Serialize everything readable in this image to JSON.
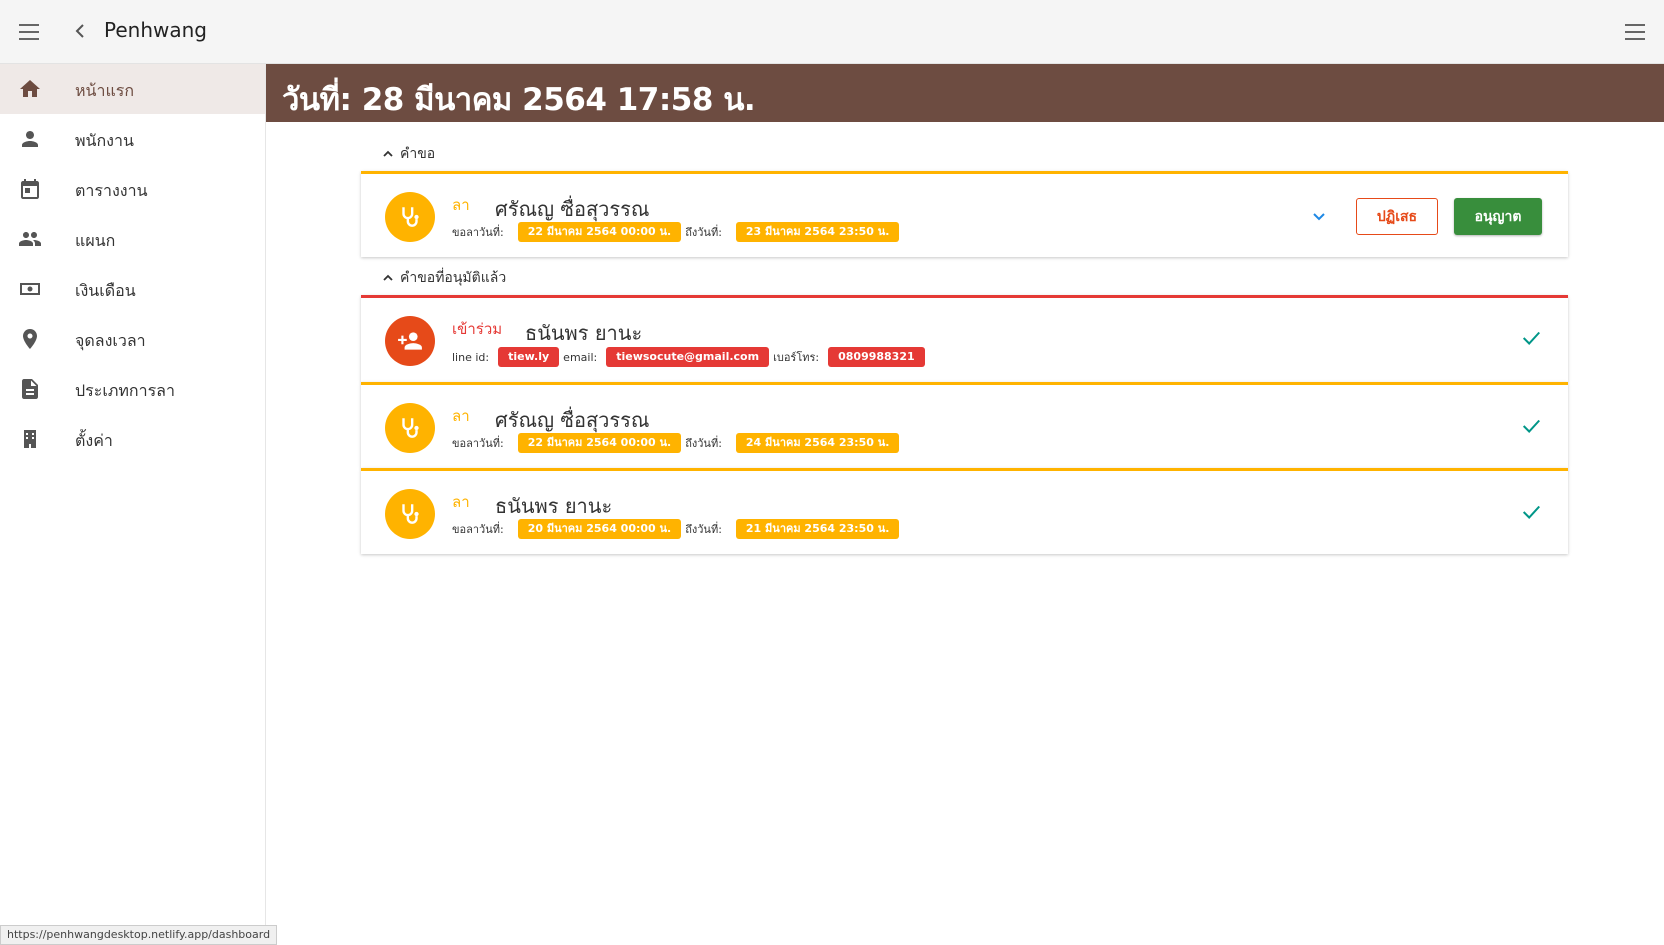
{
  "app": {
    "title": "Penhwang"
  },
  "sidebar": {
    "items": [
      {
        "label": "หน้าแรก",
        "icon": "home-icon"
      },
      {
        "label": "พนักงาน",
        "icon": "person-icon"
      },
      {
        "label": "ตารางงาน",
        "icon": "calendar-icon"
      },
      {
        "label": "แผนก",
        "icon": "group-icon"
      },
      {
        "label": "เงินเดือน",
        "icon": "money-icon"
      },
      {
        "label": "จุดลงเวลา",
        "icon": "location-pin-icon"
      },
      {
        "label": "ประเภทการลา",
        "icon": "document-icon"
      },
      {
        "label": "ตั้งค่า",
        "icon": "building-icon"
      }
    ]
  },
  "banner": {
    "title": "วันที่: 28 มีนาคม 2564 17:58 น."
  },
  "requests": {
    "heading": "คำขอ",
    "items": [
      {
        "type": "ลา",
        "name": "ศรัณญ ซื่อสุวรรณ",
        "from_label": "ขอลาวันที่:",
        "from": "22 มีนาคม 2564 00:00 น.",
        "to_label": "ถึงวันที่:",
        "to": "23 มีนาคม 2564 23:50 น.",
        "reject_label": "ปฏิเสธ",
        "approve_label": "อนุญาต"
      }
    ]
  },
  "approved": {
    "heading": "คำขอที่อนุมัติแล้ว",
    "join": {
      "type": "เข้าร่วม",
      "name": "ธนันพร ยานะ",
      "line_label": "line id:",
      "line": "tiew.ly",
      "email_label": "email:",
      "email": "tiewsocute@gmail.com",
      "phone_label": "เบอร์โทร:",
      "phone": "0809988321"
    },
    "leaves": [
      {
        "type": "ลา",
        "name": "ศรัณญ ซื่อสุวรรณ",
        "from_label": "ขอลาวันที่:",
        "from": "22 มีนาคม 2564 00:00 น.",
        "to_label": "ถึงวันที่:",
        "to": "24 มีนาคม 2564 23:50 น."
      },
      {
        "type": "ลา",
        "name": "ธนันพร ยานะ",
        "from_label": "ขอลาวันที่:",
        "from": "20 มีนาคม 2564 00:00 น.",
        "to_label": "ถึงวันที่:",
        "to": "21 มีนาคม 2564 23:50 น."
      }
    ]
  },
  "statusbar": {
    "url": "https://penhwangdesktop.netlify.app/dashboard"
  },
  "colors": {
    "brand": "#6d4c41",
    "leave": "#ffb300",
    "join": "#e53935",
    "approve": "#388e3c",
    "check": "#009688"
  }
}
